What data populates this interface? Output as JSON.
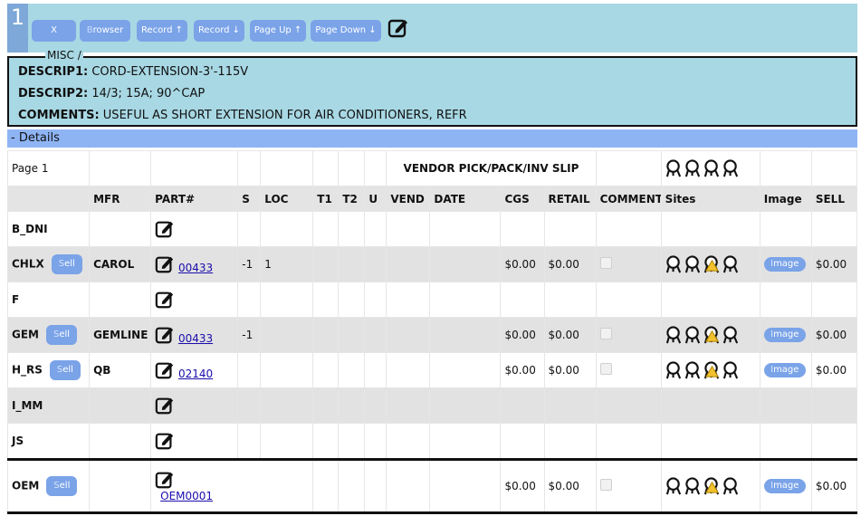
{
  "record": {
    "number": "1",
    "buttons": [
      {
        "first": "",
        "rest": "X"
      },
      {
        "first": "B",
        "rest": "rowser"
      },
      {
        "first": "",
        "rest": "Record ↑"
      },
      {
        "first": "",
        "rest": "Record ↓"
      },
      {
        "first": "",
        "rest": "Page Up ↑"
      },
      {
        "first": "",
        "rest": "Page Down ↓"
      }
    ]
  },
  "misc": {
    "legend": "MISC /",
    "descrip1_label": "DESCRIP1:",
    "descrip1_value": "CORD-EXTENSION-3'-115V",
    "descrip2_label": "DESCRIP2:",
    "descrip2_value": "14/3; 15A; 90^CAP",
    "comments_label": "COMMENTS:",
    "comments_value": "USEFUL AS SHORT EXTENSION FOR AIR CONDITIONERS, REFR"
  },
  "details": {
    "title": "- Details",
    "page_label": "Page 1",
    "slip_label": "VENDOR PICK/PACK/INV SLIP",
    "columns": [
      "",
      "MFR",
      "PART#",
      "S",
      "LOC",
      "T1",
      "T2",
      "U",
      "VEND",
      "DATE",
      "CGS",
      "RETAIL",
      "COMMENT",
      "Sites",
      "Image",
      "SELL"
    ],
    "sell_first": "S",
    "sell_rest": "ell",
    "image_first": "I",
    "image_rest": "mage",
    "rows": [
      {
        "code": "B_DNI",
        "sell": false,
        "mfr": "",
        "part": "",
        "s": "",
        "loc": "",
        "cgs": "",
        "retail": "",
        "comment": false,
        "sites": false,
        "image": false,
        "sellprice": ""
      },
      {
        "code": "CHLX",
        "sell": true,
        "mfr": "CAROL",
        "part": "00433",
        "s": "-1",
        "loc": "1",
        "cgs": "$0.00",
        "retail": "$0.00",
        "comment": true,
        "sites": true,
        "image": true,
        "sellprice": "$0.00"
      },
      {
        "code": "F",
        "sell": false,
        "mfr": "",
        "part": "",
        "s": "",
        "loc": "",
        "cgs": "",
        "retail": "",
        "comment": false,
        "sites": false,
        "image": false,
        "sellprice": ""
      },
      {
        "code": "GEM",
        "sell": true,
        "mfr": "GEMLINE",
        "part": "00433",
        "s": "-1",
        "loc": "",
        "cgs": "$0.00",
        "retail": "$0.00",
        "comment": true,
        "sites": true,
        "image": true,
        "sellprice": "$0.00"
      },
      {
        "code": "H_RS",
        "sell": true,
        "mfr": "QB",
        "part": "02140",
        "s": "",
        "loc": "",
        "cgs": "$0.00",
        "retail": "$0.00",
        "comment": true,
        "sites": true,
        "image": true,
        "sellprice": "$0.00"
      },
      {
        "code": "I_MM",
        "sell": false,
        "mfr": "",
        "part": "",
        "s": "",
        "loc": "",
        "cgs": "",
        "retail": "",
        "comment": false,
        "sites": false,
        "image": false,
        "sellprice": ""
      },
      {
        "code": "JS",
        "sell": false,
        "mfr": "",
        "part": "",
        "s": "",
        "loc": "",
        "cgs": "",
        "retail": "",
        "comment": false,
        "sites": false,
        "image": false,
        "sellprice": ""
      }
    ],
    "oem": {
      "code": "OEM",
      "part": "OEM0001",
      "cgs": "$0.00",
      "retail": "$0.00",
      "sellprice": "$0.00"
    }
  },
  "icons": [
    "edit-icon",
    "site-icon",
    "site-warning-icon"
  ],
  "colors": {
    "header_bg": "#a8d8e4",
    "button_bg": "#7aa3e8",
    "details_bar": "#8fb4f4",
    "warning": "#f2c12e"
  }
}
